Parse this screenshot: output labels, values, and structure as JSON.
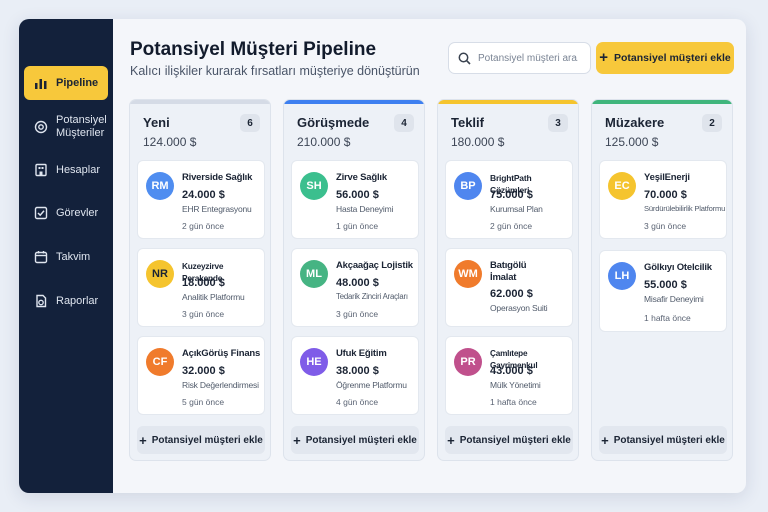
{
  "header": {
    "title": "Potansiyel Müşteri Pipeline",
    "subtitle": "Kalıcı ilişkiler kurarak fırsatları müşteriye dönüştürün",
    "search_placeholder": "Potansiyel müşteri ara...",
    "add_button": "Potansiyel müşteri ekle"
  },
  "sidebar": {
    "items": [
      {
        "label": "Pipeline",
        "icon": "chart-bar-icon",
        "active": true
      },
      {
        "label": "Potansiyel Müşteriler",
        "icon": "at-sign-icon",
        "active": false
      },
      {
        "label": "Hesaplar",
        "icon": "building-icon",
        "active": false
      },
      {
        "label": "Görevler",
        "icon": "checkbox-icon",
        "active": false
      },
      {
        "label": "Takvim",
        "icon": "calendar-icon",
        "active": false
      },
      {
        "label": "Raporlar",
        "icon": "report-icon",
        "active": false
      }
    ]
  },
  "columns": [
    {
      "name": "Yeni",
      "count": "6",
      "total": "124.000 $",
      "color": "#d5dbe6",
      "add_label": "Potansiyel müşteri ekle",
      "cards": [
        {
          "initials": "RM",
          "avatar_color": "#4f8df0",
          "name": "Riverside Sağlık",
          "amount": "24.000 $",
          "product": "EHR Entegrasyonu",
          "time": "2 gün önce"
        },
        {
          "initials": "NR",
          "avatar_color": "#f5c42e",
          "name": "Kuzeyzirve Perakende",
          "amount": "18.000 $",
          "product": "Analitik Platformu",
          "time": "3 gün önce"
        },
        {
          "initials": "CF",
          "avatar_color": "#f07b2c",
          "name": "AçıkGörüş Finans",
          "amount": "32.000 $",
          "product": "Risk Değerlendirmesi",
          "time": "5 gün önce"
        }
      ]
    },
    {
      "name": "Görüşmede",
      "count": "4",
      "total": "210.000 $",
      "color": "#3d7ff0",
      "add_label": "Potansiyel müşteri ekle",
      "cards": [
        {
          "initials": "SH",
          "avatar_color": "#3bbf8e",
          "name": "Zirve Sağlık",
          "amount": "56.000 $",
          "product": "Hasta Deneyimi",
          "time": "1 gün önce"
        },
        {
          "initials": "ML",
          "avatar_color": "#46b483",
          "name": "Akçaağaç Lojistik",
          "amount": "48.000 $",
          "product": "Tedarik Zinciri Araçları",
          "time": "3 gün önce"
        },
        {
          "initials": "HE",
          "avatar_color": "#7f5ce8",
          "name": "Ufuk Eğitim",
          "amount": "38.000 $",
          "product": "Öğrenme Platformu",
          "time": "4 gün önce"
        }
      ]
    },
    {
      "name": "Teklif",
      "count": "3",
      "total": "180.000 $",
      "color": "#f5c42e",
      "add_label": "Potansiyel müşteri ekle",
      "cards": [
        {
          "initials": "BP",
          "avatar_color": "#4f86ef",
          "name": "BrightPath Çözümleri",
          "amount": "75.000 $",
          "product": "Kurumsal Plan",
          "time": "2 gün önce"
        },
        {
          "initials": "WM",
          "avatar_color": "#f07b2c",
          "name": "Batıgölü İmalat",
          "amount": "62.000 $",
          "product": "Operasyon Suiti",
          "time": ""
        },
        {
          "initials": "PR",
          "avatar_color": "#c0508c",
          "name": "Çamlıtepe Gayrimenkul",
          "amount": "43.000 $",
          "product": "Mülk Yönetimi",
          "time": "1 hafta önce"
        }
      ]
    },
    {
      "name": "Müzakere",
      "count": "2",
      "total": "125.000 $",
      "color": "#3fb57c",
      "add_label": "Potansiyel müşteri ekle",
      "cards": [
        {
          "initials": "EC",
          "avatar_color": "#f5c42e",
          "name": "YeşilEnerji",
          "amount": "70.000 $",
          "product": "Sürdürülebilirlik Platformu",
          "time": "3 gün önce"
        },
        {
          "initials": "LH",
          "avatar_color": "#4f86ef",
          "name": "Gölkıyı Otelcilik",
          "amount": "55.000 $",
          "product": "Misafir Deneyimi",
          "time": "1 hafta önce"
        }
      ]
    }
  ]
}
